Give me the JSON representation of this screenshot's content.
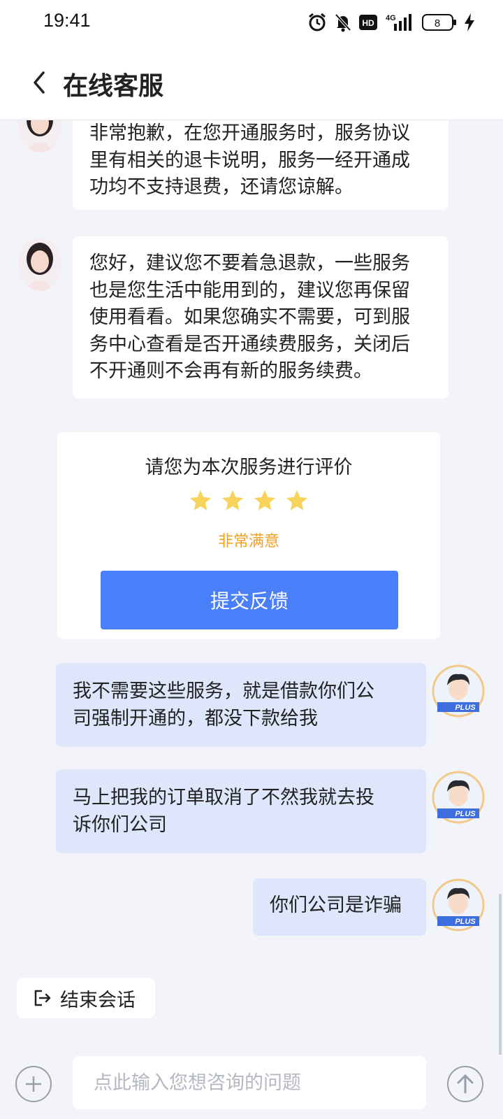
{
  "status_bar": {
    "time": "19:41",
    "battery": "8",
    "network": "4G",
    "hd": "HD",
    "icons": [
      "alarm-icon",
      "mute-icon",
      "hd-icon",
      "signal-icon",
      "battery-icon",
      "charging-icon"
    ]
  },
  "header": {
    "title": "在线客服",
    "back_icon": "chevron-left-icon"
  },
  "messages": [
    {
      "from": "agent",
      "lines": [
        "非常抱歉，在您开通服务时，服务协议",
        "里有相关的退卡说明，服务一经开通成",
        "功均不支持退费，还请您谅解。"
      ]
    },
    {
      "from": "agent",
      "lines": [
        "您好，建议您不要着急退款，一些服务",
        "也是您生活中能用到的，建议您再保留",
        "使用看看。如果您确实不需要，可到服",
        "务中心查看是否开通续费服务，关闭后",
        "不开通则不会再有新的服务续费。"
      ]
    },
    {
      "from": "user",
      "lines": [
        "我不需要这些服务，就是借款你们公",
        "司强制开通的，都没下款给我"
      ]
    },
    {
      "from": "user",
      "lines": [
        "马上把我的订单取消了不然我就去投",
        "诉你们公司"
      ]
    },
    {
      "from": "user",
      "lines": [
        "你们公司是诈骗"
      ]
    }
  ],
  "rating": {
    "title": "请您为本次服务进行评价",
    "stars": 4,
    "label": "非常满意",
    "submit_label": "提交反馈",
    "star_color": "#f7d35c"
  },
  "avatar_badge": "PLUS",
  "end_session": {
    "label": "结束会话",
    "icon": "exit-icon"
  },
  "input_bar": {
    "placeholder": "点此输入您想咨询的问题",
    "plus_icon": "plus-icon",
    "send_icon": "send-arrow-icon"
  },
  "colors": {
    "accent": "#4a7ffa",
    "user_bubble": "#dde6fb",
    "background": "#f2f4f9",
    "rating_label": "#f0a020"
  }
}
